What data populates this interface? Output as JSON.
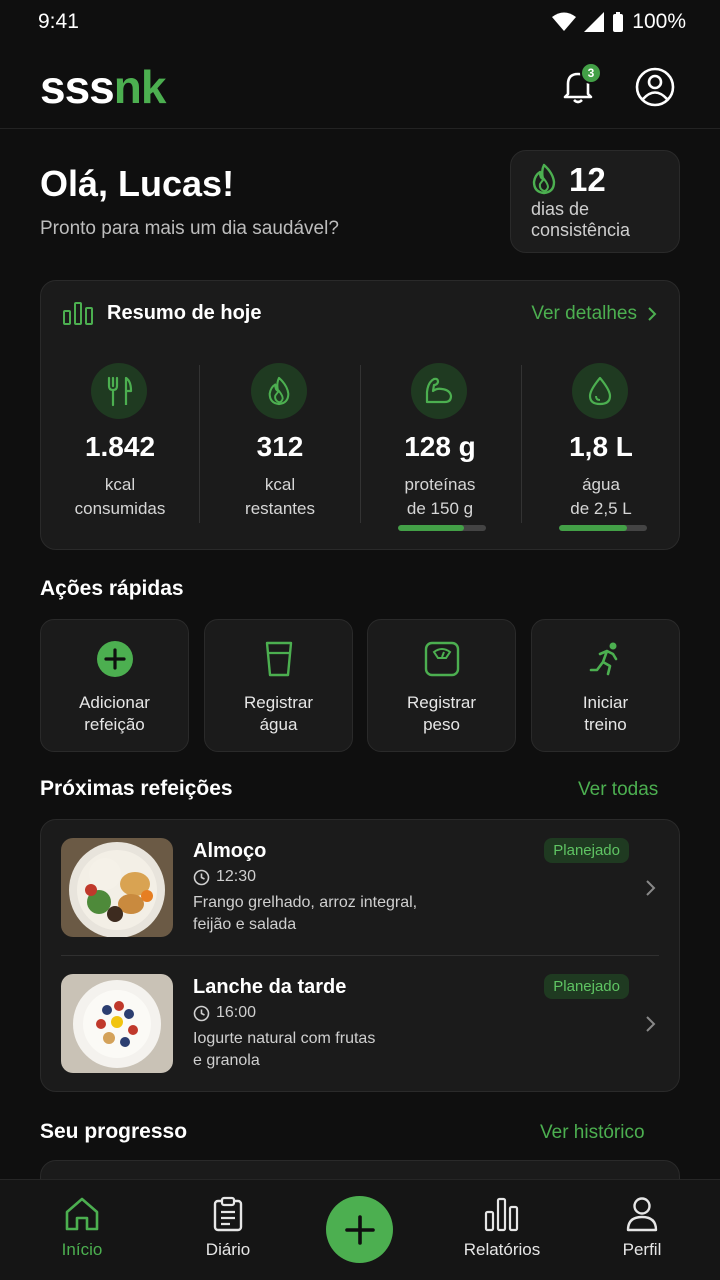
{
  "status_bar": {
    "time": "9:41",
    "battery": "100%"
  },
  "app": {
    "logo_part1": "sss",
    "logo_part2": "nk",
    "notifications_count": "3"
  },
  "greeting": {
    "title": "Olá, Lucas!",
    "subtitle": "Pronto para mais um dia saudável?"
  },
  "streak": {
    "value": "12",
    "label_line1": "dias de",
    "label_line2": "consistência"
  },
  "summary": {
    "title": "Resumo de hoje",
    "link": "Ver detalhes",
    "stats": [
      {
        "icon": "utensils-icon",
        "value": "1.842",
        "label1": "kcal",
        "label2": "consumidas"
      },
      {
        "icon": "flame-icon",
        "value": "312",
        "label1": "kcal",
        "label2": "restantes"
      },
      {
        "icon": "muscle-icon",
        "value": "128 g",
        "label1": "proteínas",
        "label2": "de 150 g",
        "progress": 0.75
      },
      {
        "icon": "water-drop-icon",
        "value": "1,8 L",
        "label1": "água",
        "label2": "de 2,5 L",
        "progress": 0.77
      }
    ]
  },
  "quick_actions": {
    "title": "Ações rápidas",
    "items": [
      {
        "icon": "add-circle-icon",
        "line1": "Adicionar",
        "line2": "refeição"
      },
      {
        "icon": "glass-icon",
        "line1": "Registrar",
        "line2": "água"
      },
      {
        "icon": "scale-icon",
        "line1": "Registrar",
        "line2": "peso"
      },
      {
        "icon": "running-icon",
        "line1": "Iniciar",
        "line2": "treino"
      }
    ]
  },
  "meals": {
    "title": "Próximas refeições",
    "link": "Ver todas",
    "items": [
      {
        "name": "Almoço",
        "time": "12:30",
        "desc_line1": "Frango grelhado, arroz integral,",
        "desc_line2": "feijão e salada",
        "badge": "Planejado"
      },
      {
        "name": "Lanche da tarde",
        "time": "16:00",
        "desc_line1": "Iogurte natural com frutas",
        "desc_line2": "e granola",
        "badge": "Planejado"
      }
    ]
  },
  "progress": {
    "title": "Seu progresso",
    "link": "Ver histórico"
  },
  "bottom_nav": {
    "items": [
      {
        "label": "Início",
        "icon": "home-icon"
      },
      {
        "label": "Diário",
        "icon": "clipboard-icon"
      },
      {
        "label": "Relatórios",
        "icon": "bar-chart-icon"
      },
      {
        "label": "Perfil",
        "icon": "user-icon"
      }
    ]
  },
  "colors": {
    "accent": "#4caf50",
    "background": "#0f0f0f",
    "card": "#1b1b1b"
  }
}
